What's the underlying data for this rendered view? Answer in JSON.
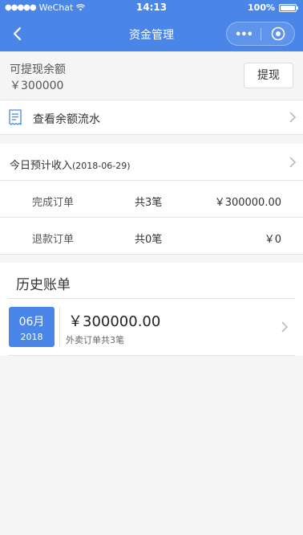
{
  "status_bar": {
    "carrier": "WeChat",
    "time": "14:13",
    "battery": "100%"
  },
  "nav": {
    "title": "资金管理"
  },
  "balance": {
    "label": "可提现余额",
    "value": "￥300000",
    "withdraw_label": "提现"
  },
  "flow": {
    "label": "查看余额流水"
  },
  "income": {
    "title": "今日预计收入",
    "date": "(2018-06-29)",
    "rows": [
      {
        "name": "完成订单",
        "count": "共3笔",
        "amount": "￥300000.00"
      },
      {
        "name": "退款订单",
        "count": "共0笔",
        "amount": "￥0"
      }
    ]
  },
  "history": {
    "title": "历史账单",
    "bills": [
      {
        "month": "06月",
        "year": "2018",
        "amount": "￥300000.00",
        "desc": "外卖订单共3笔"
      }
    ]
  },
  "colors": {
    "accent": "#4a86e8"
  },
  "icons": [
    "back-icon",
    "more-icon",
    "target-icon",
    "ledger-icon",
    "chevron-right-icon",
    "wifi-icon",
    "battery-icon"
  ]
}
